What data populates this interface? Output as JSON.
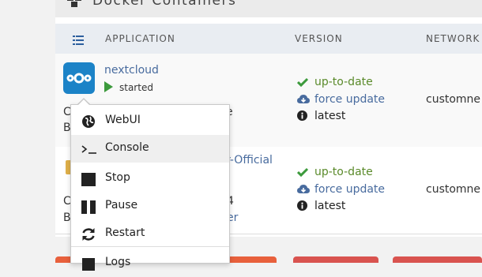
{
  "panel": {
    "title": "Docker Containers"
  },
  "table": {
    "headers": {
      "application": "APPLICATION",
      "version": "VERSION",
      "network": "NETWORK"
    }
  },
  "rows": [
    {
      "name": "nextcloud",
      "state": "started",
      "left_partial_1": "C",
      "left_partial_2": "B",
      "right_partial": "e",
      "versions": [
        "up-to-date",
        "force update",
        "latest"
      ],
      "network": "customne"
    },
    {
      "name_partial": "r-Official",
      "left_partial_1": "C",
      "left_partial_2": "B",
      "mid_partial_1": "4",
      "mid_partial_2": "er",
      "versions": [
        "up-to-date",
        "force update",
        "latest"
      ],
      "network": "customne"
    }
  ],
  "context_menu": {
    "items": [
      {
        "label": "WebUI",
        "icon": "globe-icon"
      },
      {
        "label": "Console",
        "icon": "terminal-icon"
      },
      {
        "label": "Stop",
        "icon": "stop-icon"
      },
      {
        "label": "Pause",
        "icon": "pause-icon"
      },
      {
        "label": "Restart",
        "icon": "restart-icon"
      },
      {
        "label": "Logs",
        "icon": "logs-icon"
      }
    ],
    "hovered": "Console"
  },
  "colors": {
    "accent": "#486b9e",
    "status_green": "#5a8a2a",
    "nextcloud_blue": "#1c83c7",
    "bottom_orange": "#e8603c",
    "bottom_red": "#d9534f"
  }
}
